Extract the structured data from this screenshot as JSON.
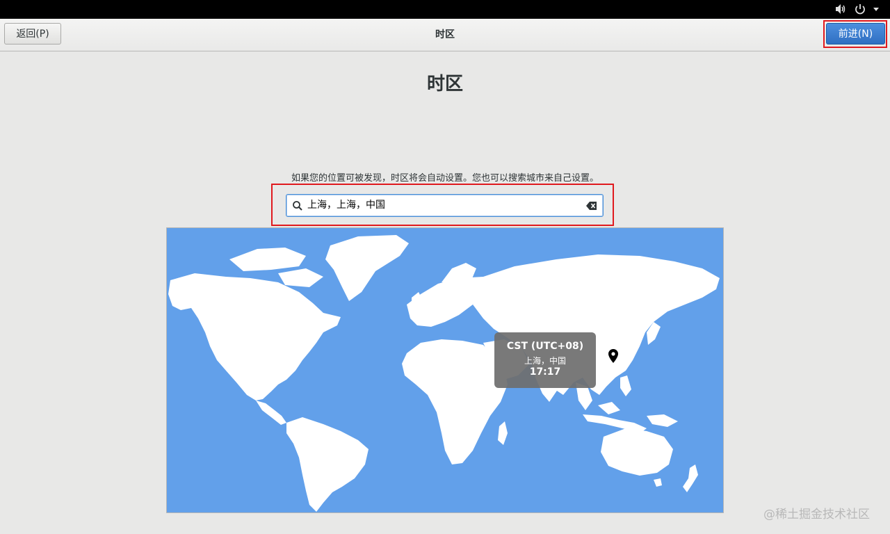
{
  "system_tray": {
    "volume_icon": "speaker-icon",
    "power_icon": "power-icon",
    "menu_icon": "caret-down-icon"
  },
  "header": {
    "back_label": "返回(P)",
    "title": "时区",
    "next_label": "前进(N)"
  },
  "page": {
    "title": "时区",
    "hint": "如果您的位置可被发现，时区将会自动设置。您也可以搜索城市来自己设置。"
  },
  "search": {
    "value": "上海，上海，中国",
    "search_icon": "search-icon",
    "clear_icon": "clear-icon"
  },
  "timezone_popup": {
    "abbr": "CST (UTC+08)",
    "city": "上海，中国",
    "time": "17:17"
  },
  "watermark": "@稀土掘金技术社区",
  "colors": {
    "ocean": "#62a0ea",
    "land": "#ffffff",
    "accent": "#3584e4",
    "highlight": "#e0191e"
  }
}
